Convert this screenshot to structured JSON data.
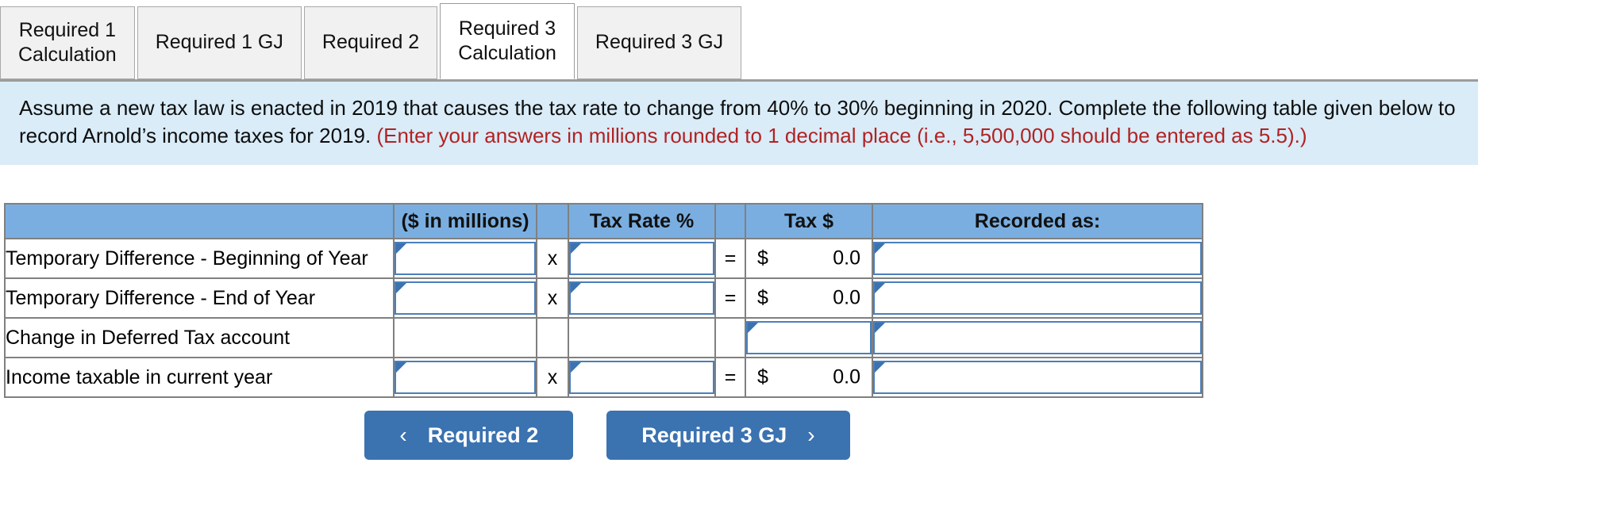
{
  "tabs": [
    {
      "label": "Required 1\nCalculation",
      "active": false
    },
    {
      "label": "Required 1 GJ",
      "active": false
    },
    {
      "label": "Required 2",
      "active": false
    },
    {
      "label": "Required 3\nCalculation",
      "active": true
    },
    {
      "label": "Required 3 GJ",
      "active": false
    }
  ],
  "instructions": {
    "black_text": "Assume a new tax law is enacted in 2019 that causes the tax rate to change from 40% to 30% beginning in 2020. Complete the following table given below to record Arnold’s income taxes for 2019. ",
    "red_text": "(Enter your answers in millions rounded to 1 decimal place (i.e., 5,500,000 should be entered as 5.5).)"
  },
  "table": {
    "headers": {
      "label": "",
      "amount": "($ in millions)",
      "x": "",
      "rate": "Tax Rate %",
      "eq": "",
      "tax": "Tax $",
      "recorded": "Recorded as:"
    },
    "rows": [
      {
        "label": "Temporary Difference - Beginning of Year",
        "amount_value": "",
        "operator_x": "x",
        "rate_value": "",
        "operator_eq": "=",
        "tax_dollar": "$",
        "tax_amount": "0.0",
        "recorded_value": "",
        "has_amount_input": true,
        "has_rate_input": true,
        "tax_is_input": false,
        "has_recorded_input": true
      },
      {
        "label": "Temporary Difference - End of Year",
        "amount_value": "",
        "operator_x": "x",
        "rate_value": "",
        "operator_eq": "=",
        "tax_dollar": "$",
        "tax_amount": "0.0",
        "recorded_value": "",
        "has_amount_input": true,
        "has_rate_input": true,
        "tax_is_input": false,
        "has_recorded_input": true
      },
      {
        "label": "Change in Deferred Tax account",
        "amount_value": "",
        "operator_x": "",
        "rate_value": "",
        "operator_eq": "",
        "tax_dollar": "",
        "tax_amount": "",
        "recorded_value": "",
        "has_amount_input": false,
        "has_rate_input": false,
        "tax_is_input": true,
        "has_recorded_input": true
      },
      {
        "label": "Income taxable in current year",
        "amount_value": "",
        "operator_x": "x",
        "rate_value": "",
        "operator_eq": "=",
        "tax_dollar": "$",
        "tax_amount": "0.0",
        "recorded_value": "",
        "has_amount_input": true,
        "has_rate_input": true,
        "tax_is_input": false,
        "has_recorded_input": true
      }
    ]
  },
  "nav": {
    "prev_label": "Required 2",
    "prev_chevron": "‹",
    "next_label": "Required 3 GJ",
    "next_chevron": "›"
  },
  "colors": {
    "header_blue": "#7aaee0",
    "instruction_bg": "#d9ecf8",
    "red_text": "#b22222",
    "button_blue": "#3b72b0",
    "field_border": "#4a7fba"
  }
}
